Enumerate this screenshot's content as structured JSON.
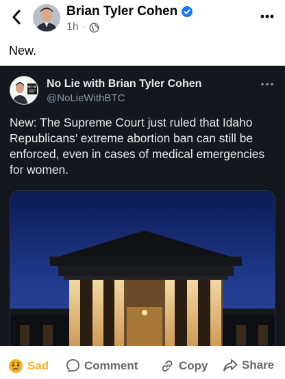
{
  "header": {
    "author_name": "Brian Tyler Cohen",
    "timestamp": "1h",
    "separator": "·",
    "verified": true,
    "back_icon": "chevron-left-icon",
    "privacy_icon": "globe-icon",
    "more_icon": "more-horizontal-icon"
  },
  "post": {
    "text": "New."
  },
  "embedded_tweet": {
    "avatar_text": "NO LIE",
    "display_name": "No Lie with Brian Tyler Cohen",
    "handle": "@NoLieWithBTC",
    "body": "New: The Supreme Court just ruled that Idaho Republicans’ extreme abortion ban can still be enforced, even in cases of medical emergencies for women.",
    "image_subject": "Supreme Court building at dusk"
  },
  "actions": {
    "sad_label": "Sad",
    "comment_label": "Comment",
    "copy_label": "Copy",
    "share_label": "Share"
  },
  "colors": {
    "verified_blue": "#1877f2",
    "sad_yellow": "#f7b125",
    "card_bg": "#14171e",
    "muted_text": "#65676b"
  }
}
